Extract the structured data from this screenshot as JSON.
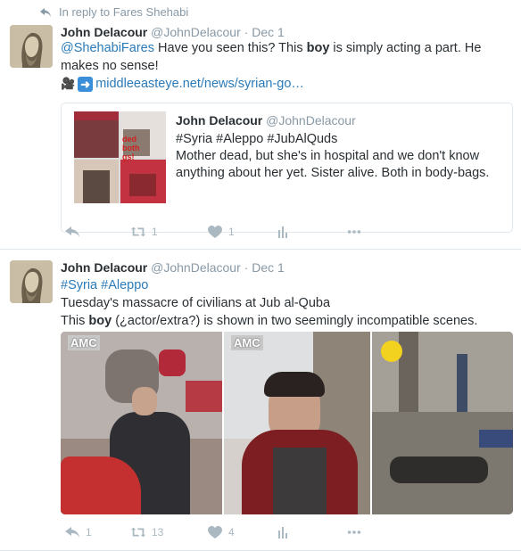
{
  "reply_context": "In reply to Fares Shehabi",
  "tweet1": {
    "name": "John Delacour",
    "handle": "@JohnDelacour",
    "separator": "·",
    "date": "Dec 1",
    "mention": "@ShehabiFares",
    "text_a": " Have you seen this?  This ",
    "text_bold": "boy",
    "text_b": " is simply acting a part. He makes no sense!",
    "link_text": "middleeasteye.net/news/syrian-go…",
    "quote": {
      "name": "John Delacour",
      "handle": "@JohnDelacour",
      "line1": "#Syria #Aleppo #JubAlQuds",
      "line2": "Mother dead, but she's in hospital and we don't know anything about her yet. Sister alive. Both in body-bags."
    },
    "actions": {
      "reply": "",
      "retweet": "1",
      "like": "1"
    }
  },
  "tweet2": {
    "name": "John Delacour",
    "handle": "@JohnDelacour",
    "separator": "·",
    "date": "Dec 1",
    "hashtags": "#Syria #Aleppo",
    "line1": "Tuesday's massacre of civilians at Jub al-Quba",
    "line2_a": "This ",
    "line2_bold": "boy",
    "line2_b": " (¿actor/extra?) is shown in two seemingly incompatible scenes.",
    "media_logo": "AMC",
    "actions": {
      "reply": "1",
      "retweet": "13",
      "like": "4"
    }
  },
  "colors": {
    "link": "#2b7bb9",
    "muted": "#8899a6",
    "action": "#aab8c2",
    "border": "#e1e8ed"
  },
  "icons": [
    "reply-icon",
    "retweet-icon",
    "heart-icon",
    "analytics-icon",
    "more-icon",
    "camera-icon",
    "arrow-icon"
  ]
}
